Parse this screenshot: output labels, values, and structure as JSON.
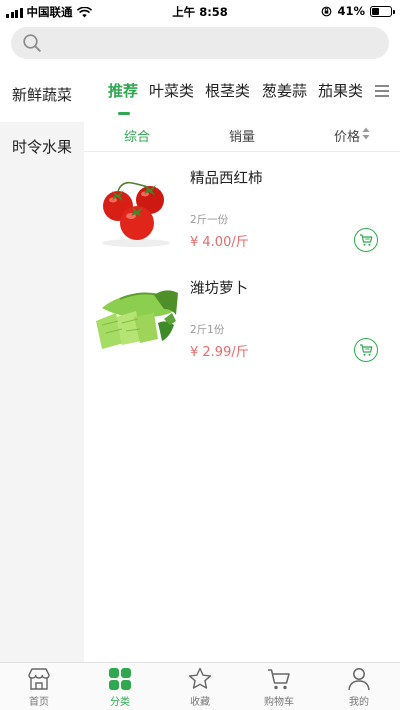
{
  "status_bar": {
    "carrier": "中国联通",
    "time": "上午 8:58",
    "battery_percent": "41%",
    "battery_level": 0.41,
    "icons": [
      "signal-icon",
      "wifi-icon",
      "orientation-lock-icon",
      "battery-icon"
    ]
  },
  "search": {
    "placeholder": "",
    "icon": "search-icon"
  },
  "sidebar": {
    "items": [
      {
        "label": "新鲜蔬菜",
        "active": true
      },
      {
        "label": "时令水果",
        "active": false
      }
    ]
  },
  "tabs": {
    "items": [
      {
        "label": "推荐",
        "active": true
      },
      {
        "label": "叶菜类",
        "active": false
      },
      {
        "label": "根茎类",
        "active": false
      },
      {
        "label": "葱姜蒜",
        "active": false
      },
      {
        "label": "茄果类",
        "active": false
      }
    ],
    "more_icon": "menu-icon"
  },
  "sort_bar": {
    "items": [
      {
        "label": "综合",
        "active": true
      },
      {
        "label": "销量",
        "active": false
      },
      {
        "label": "价格",
        "active": false
      }
    ]
  },
  "products": [
    {
      "name": "精品西红柿",
      "spec": "2斤一份",
      "price": "¥ 4.00/斤",
      "image": "tomato-image"
    },
    {
      "name": "潍坊萝卜",
      "spec": "2斤1份",
      "price": "¥ 2.99/斤",
      "image": "radish-image"
    }
  ],
  "bottom_nav": {
    "items": [
      {
        "label": "首页",
        "icon": "home-icon",
        "active": false
      },
      {
        "label": "分类",
        "icon": "category-icon",
        "active": true
      },
      {
        "label": "收藏",
        "icon": "star-icon",
        "active": false
      },
      {
        "label": "购物车",
        "icon": "cart-icon",
        "active": false
      },
      {
        "label": "我的",
        "icon": "user-icon",
        "active": false
      }
    ]
  },
  "colors": {
    "accent": "#2fa84f",
    "price": "#e86a6a",
    "sidebar_bg": "#f4f4f4",
    "search_bg": "#ebebeb"
  }
}
